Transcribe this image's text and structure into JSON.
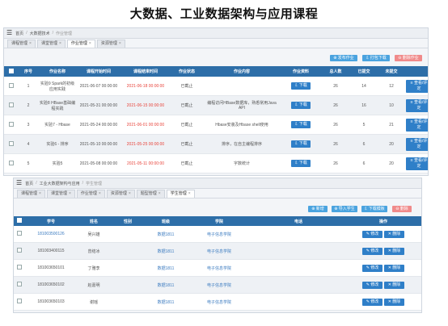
{
  "headline": "大数据、工业数据架构与应用课程",
  "panel1": {
    "breadcrumb": [
      "首页",
      "大数据技术",
      "作业管理"
    ],
    "tabs": [
      "课程管理",
      "课堂管理",
      "作业管理",
      "资源管理"
    ],
    "active_tab": 2,
    "toolbar": {
      "publish": "发布作业",
      "print": "打包下载",
      "delete": "删除作业"
    },
    "columns": [
      "序号",
      "作业名称",
      "课程开始时间",
      "课程结束时间",
      "作业状态",
      "作业内容",
      "作业资料",
      "总人数",
      "已提交",
      "未提交",
      ""
    ],
    "download_label": "下载",
    "action_label": "查看/评定",
    "rows": [
      {
        "no": "1",
        "name": "实验9 Spark的初级应用实践",
        "start": "2021-06-07 00:00:00",
        "end": "2021-06-18 00:00:00",
        "status": "已截止",
        "content": "",
        "total": "26",
        "submitted": "14",
        "pending": "12"
      },
      {
        "no": "2",
        "name": "实验8 HBase基础编程实践",
        "start": "2021-05-31 00:00:00",
        "end": "2021-06-15 00:00:00",
        "status": "已截止",
        "content": "编程访问HBase数据库，熟悉常用Java API",
        "total": "26",
        "submitted": "16",
        "pending": "10"
      },
      {
        "no": "3",
        "name": "实验7 - Hbase",
        "start": "2021-05-24 00:00:00",
        "end": "2021-06-01 00:00:00",
        "status": "已截止",
        "content": "Hbase安装及Hbase shell使用",
        "total": "26",
        "submitted": "5",
        "pending": "21"
      },
      {
        "no": "4",
        "name": "实验6 - 排序",
        "start": "2021-05-10 00:00:00",
        "end": "2021-05-25 00:00:00",
        "status": "已截止",
        "content": "排序，在自主编程排序",
        "total": "26",
        "submitted": "6",
        "pending": "20"
      },
      {
        "no": "5",
        "name": "实验5",
        "start": "2021-05-08 00:00:00",
        "end": "2021-05-11 00:00:00",
        "status": "已截止",
        "content": "字数统计",
        "total": "26",
        "submitted": "6",
        "pending": "20"
      }
    ]
  },
  "panel2": {
    "breadcrumb": [
      "首页",
      "工业大数据架构与应用",
      "学生管理"
    ],
    "tabs": [
      "课程管理",
      "课堂管理",
      "作业管理",
      "资源管理",
      "题型管理",
      "学生管理"
    ],
    "active_tab": 5,
    "toolbar": {
      "add": "新增",
      "import": "导入学生",
      "download": "下载模板",
      "delete": "删除"
    },
    "columns": [
      "学号",
      "姓名",
      "性别",
      "班级",
      "学院",
      "电话",
      "操作"
    ],
    "edit_label": "修改",
    "remove_label": "删除",
    "rows": [
      {
        "id": "181003500126",
        "name": "吴兴雄",
        "gender": "",
        "class": "数据1811",
        "college": "电子信息学院",
        "phone": ""
      },
      {
        "id": "181003400115",
        "name": "曾结冰",
        "gender": "",
        "class": "数据1811",
        "college": "电子信息学院",
        "phone": ""
      },
      {
        "id": "181003650101",
        "name": "丁雅李",
        "gender": "",
        "class": "数据1811",
        "college": "电子信息学院",
        "phone": ""
      },
      {
        "id": "181003650102",
        "name": "赵嘉明",
        "gender": "",
        "class": "数据1811",
        "college": "电子信息学院",
        "phone": ""
      },
      {
        "id": "181003650103",
        "name": "谢瑶",
        "gender": "",
        "class": "数据1811",
        "college": "电子信息学院",
        "phone": ""
      }
    ]
  }
}
